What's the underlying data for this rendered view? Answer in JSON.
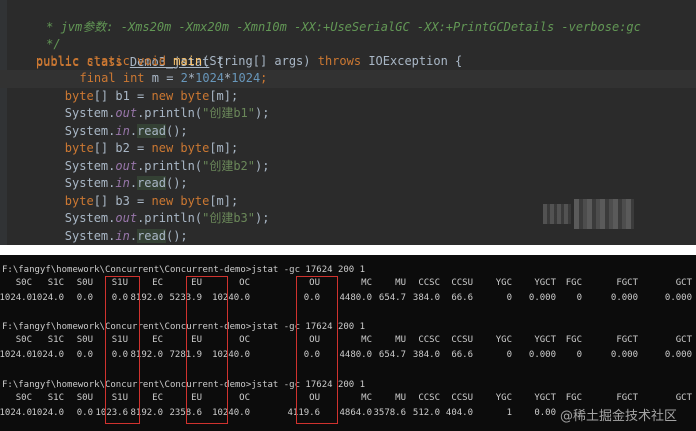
{
  "editor": {
    "comment_line": " * jvm参数: -Xms20m -Xmx20m -Xmn10m -XX:+UseSerialGC -XX:+PrintGCDetails -verbose:gc",
    "comment_end": " */",
    "kw_public": "public",
    "kw_class": "class",
    "class_name": "Demo3_jstat",
    "brace_open": " {",
    "kw_static": "static",
    "kw_void": "void",
    "main_name": "main",
    "main_params": "(String[] args) ",
    "kw_throws": "throws",
    "exception": " IOException {",
    "kw_final": "final",
    "kw_int": "int",
    "m_decl": " m = ",
    "num_2": "2",
    "num_1024": "1024",
    "star": "*",
    "semicolon": ";",
    "byte_arr": "byte",
    "arr_b1": "[] b1 = ",
    "arr_b2": "[] b2 = ",
    "arr_b3": "[] b3 = ",
    "kw_new": "new",
    "byte_m": "[m];",
    "sys": "System.",
    "out": "out",
    "println": ".println(",
    "str_b1": "\"创建b1\"",
    "str_b2": "\"创建b2\"",
    "str_b3": "\"创建b3\"",
    "close_paren": ");",
    "in": "in",
    "dot": ".",
    "read": "read",
    "read_end": "();"
  },
  "terminal": {
    "prompt": "F:\\fangyf\\homework\\Concurrent\\Concurrent-demo>jstat -gc 17624 200 1",
    "headers": [
      "S0C",
      "S1C",
      "S0U",
      "S1U",
      "EC",
      "EU",
      "OC",
      "OU",
      "MC",
      "MU",
      "CCSC",
      "CCSU",
      "YGC",
      "YGCT",
      "FGC",
      "FGCT",
      "GCT"
    ],
    "runs": [
      [
        "1024.0",
        "1024.0",
        "0.0",
        "0.0",
        "8192.0",
        "5233.9",
        "10240.0",
        "0.0",
        "4480.0",
        "654.7",
        "384.0",
        "66.6",
        "0",
        "0.000",
        "0",
        "0.000",
        "0.000"
      ],
      [
        "1024.0",
        "1024.0",
        "0.0",
        "0.0",
        "8192.0",
        "7281.9",
        "10240.0",
        "0.0",
        "4480.0",
        "654.7",
        "384.0",
        "66.6",
        "0",
        "0.000",
        "0",
        "0.000",
        "0.000"
      ],
      [
        "1024.0",
        "1024.0",
        "0.0",
        "1023.6",
        "8192.0",
        "2358.6",
        "10240.0",
        "4119.6",
        "4864.0",
        "3578.6",
        "512.0",
        "404.0",
        "1",
        "0.00",
        "",
        "",
        ""
      ]
    ]
  },
  "watermark": {
    "text": "@稀土掘金技术社区"
  },
  "colors": {
    "editor_bg": "#2b2b2b",
    "terminal_bg": "#0c0c0c",
    "highlight_box": "#d0322e"
  }
}
